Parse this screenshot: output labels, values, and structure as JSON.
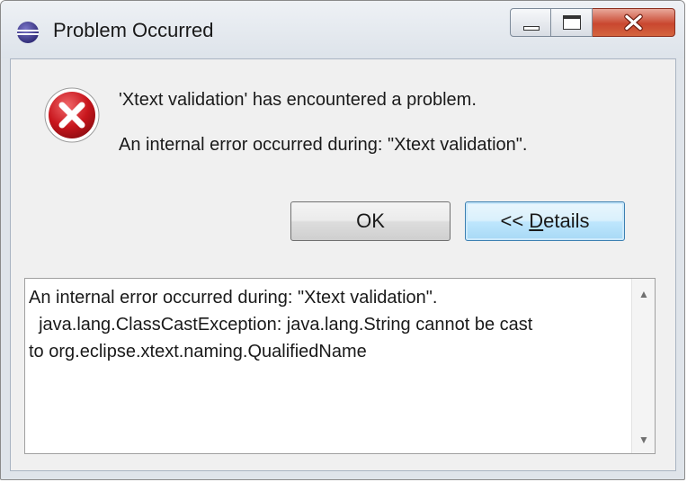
{
  "window": {
    "title": "Problem Occurred",
    "icon": "eclipse-icon",
    "controls": {
      "minimize": "minimize-icon",
      "maximize": "maximize-icon",
      "close": "close-icon"
    }
  },
  "dialog": {
    "icon": "error-icon",
    "message": "'Xtext validation' has encountered a problem.",
    "detail_message": "An internal error occurred during: \"Xtext validation\".",
    "buttons": {
      "ok": "OK",
      "details_prefix": "<< ",
      "details_mnemonic": "D",
      "details_rest": "etails"
    },
    "details_lines": [
      "An internal error occurred during: \"Xtext validation\".",
      "  java.lang.ClassCastException: java.lang.String cannot be cast",
      "to org.eclipse.xtext.naming.QualifiedName"
    ]
  },
  "colors": {
    "close_button": "#c9472f",
    "error_red": "#c8161d",
    "default_button_border": "#3c7fb1"
  }
}
